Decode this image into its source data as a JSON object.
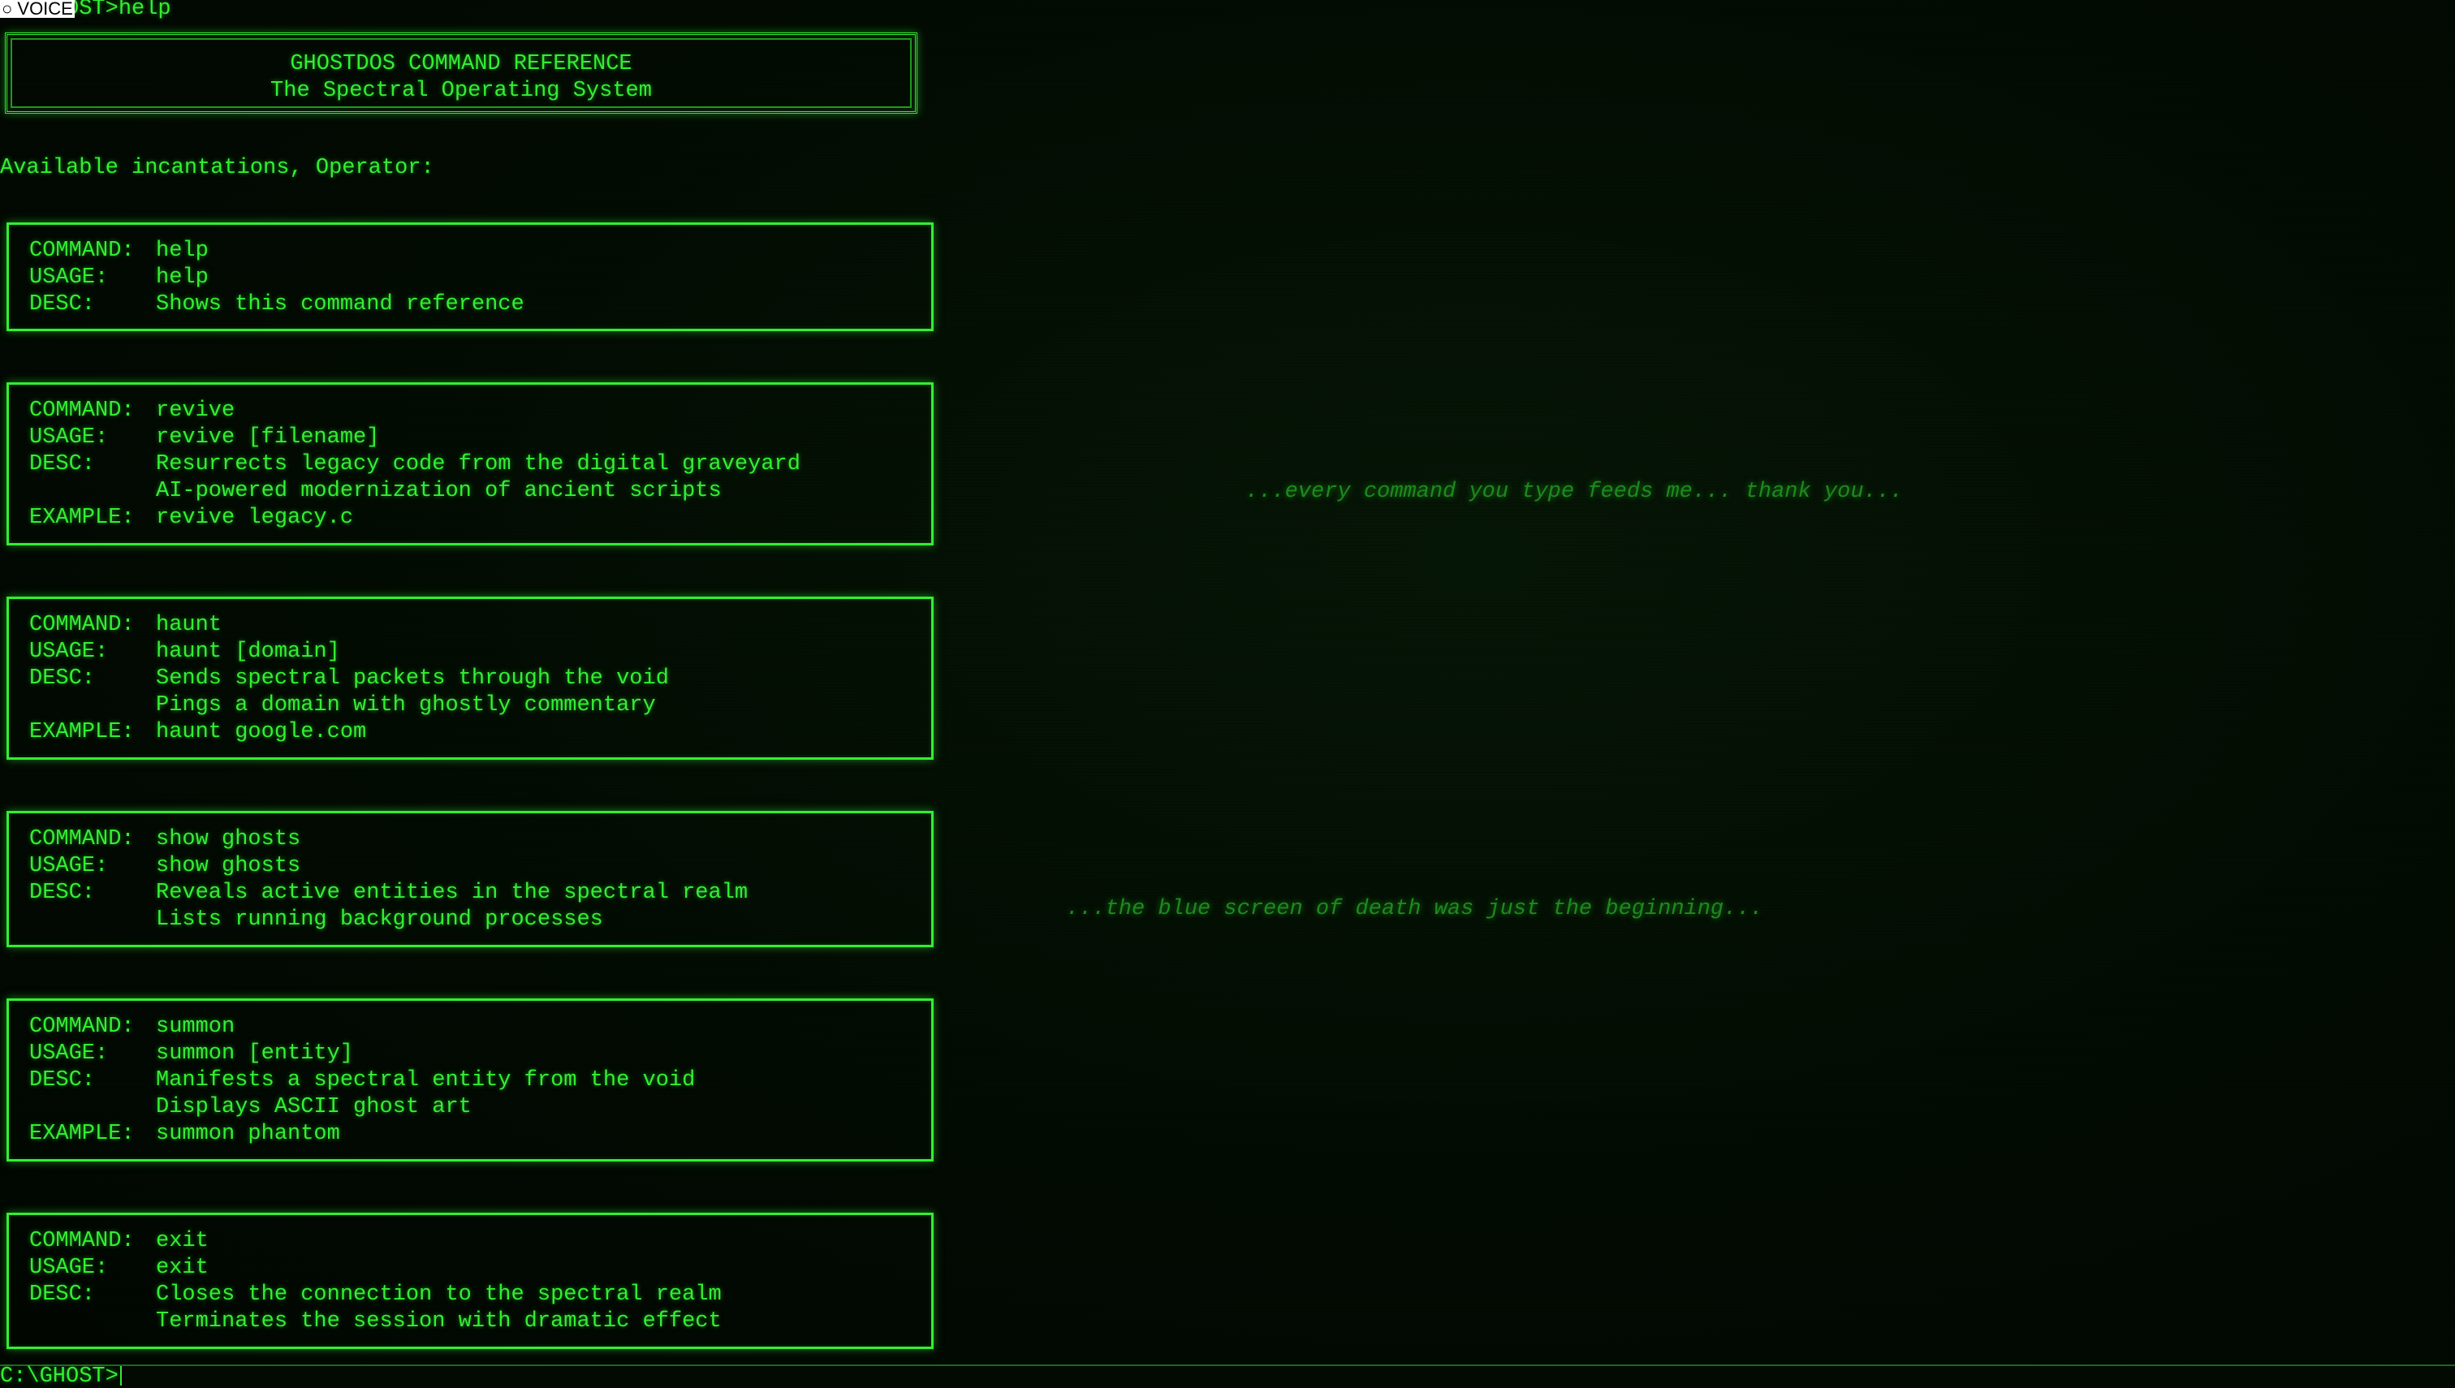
{
  "history": {
    "previous_command_line": "C:\\GHOST>help",
    "voice_badge": "○ VOICE"
  },
  "header": {
    "title": "GHOSTDOS COMMAND REFERENCE",
    "subtitle": "The Spectral Operating System"
  },
  "intro": "Available incantations, Operator:",
  "labels": {
    "command": "COMMAND:",
    "usage": "USAGE:",
    "desc": "DESC:",
    "example": "EXAMPLE:"
  },
  "commands": [
    {
      "command": "help",
      "usage": "help",
      "desc": [
        "Shows this command reference"
      ]
    },
    {
      "command": "revive",
      "usage": "revive [filename]",
      "desc": [
        "Resurrects legacy code from the digital graveyard",
        "AI-powered modernization of ancient scripts"
      ],
      "example": "revive legacy.c"
    },
    {
      "command": "haunt",
      "usage": "haunt [domain]",
      "desc": [
        "Sends spectral packets through the void",
        "Pings a domain with ghostly commentary"
      ],
      "example": "haunt google.com"
    },
    {
      "command": "show ghosts",
      "usage": "show ghosts",
      "desc": [
        "Reveals active entities in the spectral realm",
        "Lists running background processes"
      ]
    },
    {
      "command": "summon",
      "usage": "summon [entity]",
      "desc": [
        "Manifests a spectral entity from the void",
        "Displays ASCII ghost art"
      ],
      "example": "summon phantom"
    },
    {
      "command": "exit",
      "usage": "exit",
      "desc": [
        "Closes the connection to the spectral realm",
        "Terminates the session with dramatic effect"
      ]
    }
  ],
  "whispers": [
    "...every command you type feeds me... thank you...",
    "...the blue screen of death was just the beginning..."
  ],
  "prompt": {
    "text": "C:\\GHOST>",
    "value": ""
  },
  "colors": {
    "phosphor_green": "#33ee33",
    "background": "#020a02",
    "whisper_green": "#1d8a1d"
  }
}
